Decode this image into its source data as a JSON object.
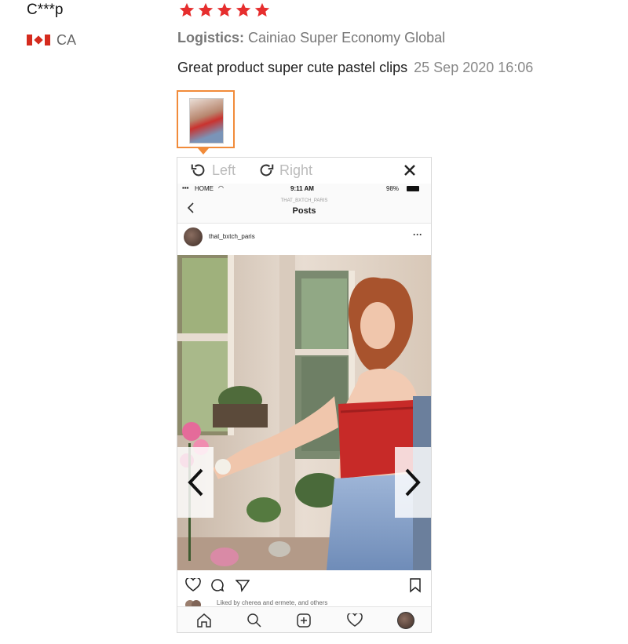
{
  "reviewer": {
    "name": "C***p",
    "country": "CA",
    "flag": "canada-flag"
  },
  "rating": {
    "stars": 5,
    "max": 5,
    "color": "#e62e2e"
  },
  "logistics": {
    "label": "Logistics:",
    "value": "Cainiao Super Economy Global"
  },
  "review": {
    "text": "Great product super cute pastel clips",
    "date": "25 Sep 2020 16:06"
  },
  "viewer": {
    "rotate_left": "Left",
    "rotate_right": "Right",
    "accent": "#f18b3a"
  },
  "phone": {
    "carrier": "HOME",
    "time": "9:11 AM",
    "battery": "98%",
    "profile_handle": "THAT_BXTCH_PARIS",
    "screen_title": "Posts",
    "post_user": "that_bxtch_paris",
    "likes_text": "Liked by cherea and ermete, and others"
  }
}
